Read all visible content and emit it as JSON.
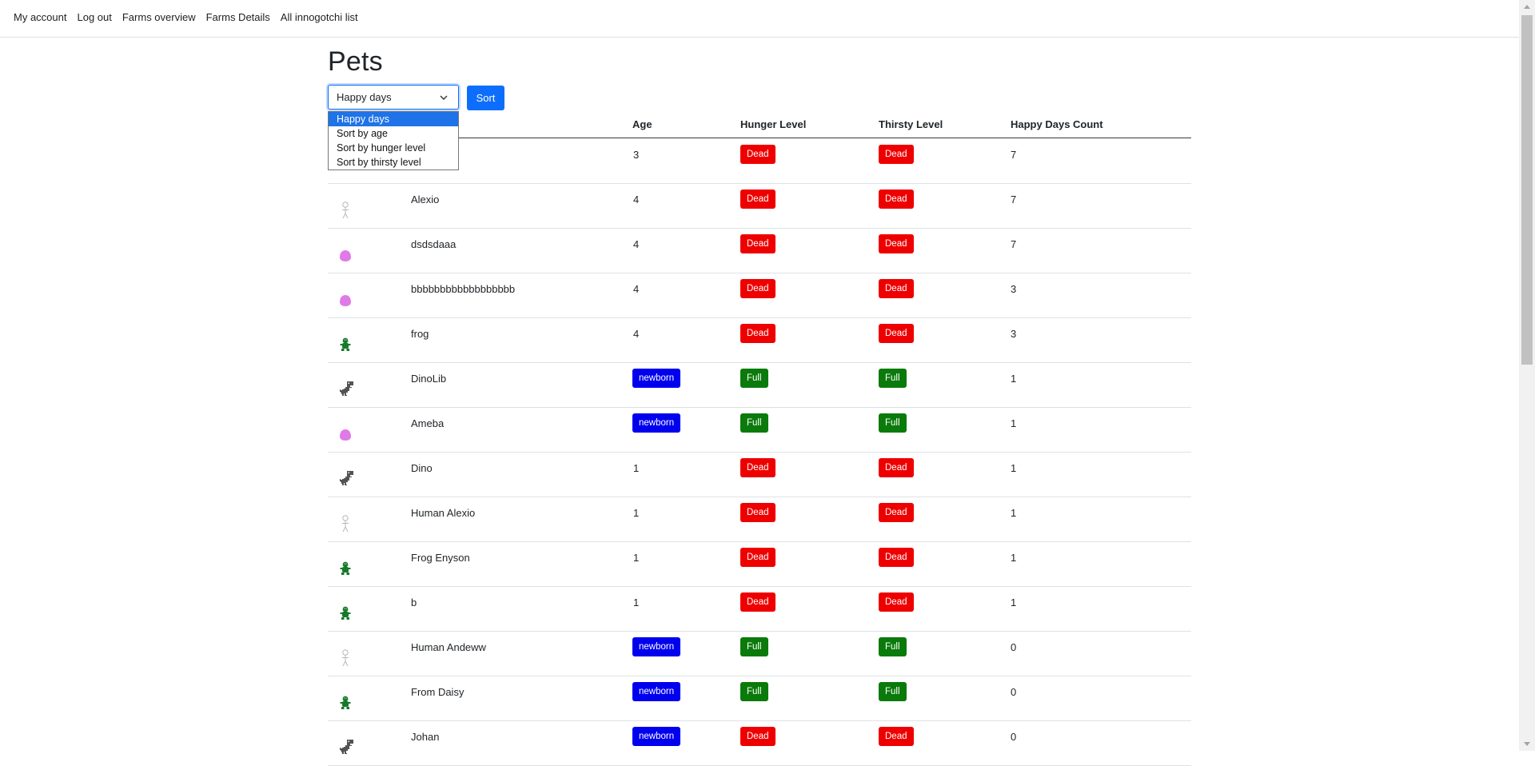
{
  "nav": [
    "My account",
    "Log out",
    "Farms overview",
    "Farms Details",
    "All innogotchi list"
  ],
  "page": {
    "title": "Pets"
  },
  "sort": {
    "selected": "Happy days",
    "button_label": "Sort",
    "options": [
      "Happy days",
      "Sort by age",
      "Sort by hunger level",
      "Sort by thirsty level"
    ]
  },
  "table": {
    "headers": [
      "Age",
      "Hunger Level",
      "Thirsty Level",
      "Happy Days Count"
    ],
    "rows": [
      {
        "icon": "",
        "name": "",
        "age": "3",
        "hunger": "Dead",
        "thirst": "Dead",
        "happy": "7"
      },
      {
        "icon": "human-icon",
        "name": "Alexio",
        "age": "4",
        "hunger": "Dead",
        "thirst": "Dead",
        "happy": "7"
      },
      {
        "icon": "blob-icon",
        "name": "dsdsdaaa",
        "age": "4",
        "hunger": "Dead",
        "thirst": "Dead",
        "happy": "7"
      },
      {
        "icon": "blob-icon",
        "name": "bbbbbbbbbbbbbbbbbb",
        "age": "4",
        "hunger": "Dead",
        "thirst": "Dead",
        "happy": "3"
      },
      {
        "icon": "frog-icon",
        "name": "frog",
        "age": "4",
        "hunger": "Dead",
        "thirst": "Dead",
        "happy": "3"
      },
      {
        "icon": "dino-icon",
        "name": "DinoLib",
        "age": "newborn",
        "hunger": "Full",
        "thirst": "Full",
        "happy": "1"
      },
      {
        "icon": "blob-icon",
        "name": "Ameba",
        "age": "newborn",
        "hunger": "Full",
        "thirst": "Full",
        "happy": "1"
      },
      {
        "icon": "dino-icon",
        "name": "Dino",
        "age": "1",
        "hunger": "Dead",
        "thirst": "Dead",
        "happy": "1"
      },
      {
        "icon": "human-icon",
        "name": "Human Alexio",
        "age": "1",
        "hunger": "Dead",
        "thirst": "Dead",
        "happy": "1"
      },
      {
        "icon": "frog-icon",
        "name": "Frog Enyson",
        "age": "1",
        "hunger": "Dead",
        "thirst": "Dead",
        "happy": "1"
      },
      {
        "icon": "frog-icon",
        "name": "b",
        "age": "1",
        "hunger": "Dead",
        "thirst": "Dead",
        "happy": "1"
      },
      {
        "icon": "human-icon",
        "name": "Human Andeww",
        "age": "newborn",
        "hunger": "Full",
        "thirst": "Full",
        "happy": "0"
      },
      {
        "icon": "frog-icon",
        "name": "From Daisy",
        "age": "newborn",
        "hunger": "Full",
        "thirst": "Full",
        "happy": "0"
      },
      {
        "icon": "dino-icon",
        "name": "Johan",
        "age": "newborn",
        "hunger": "Dead",
        "thirst": "Dead",
        "happy": "0"
      }
    ]
  },
  "colors": {
    "dead": "#ee0000",
    "full": "#0a7a0a",
    "newborn": "#0000ee",
    "primary": "#0d6efd"
  }
}
